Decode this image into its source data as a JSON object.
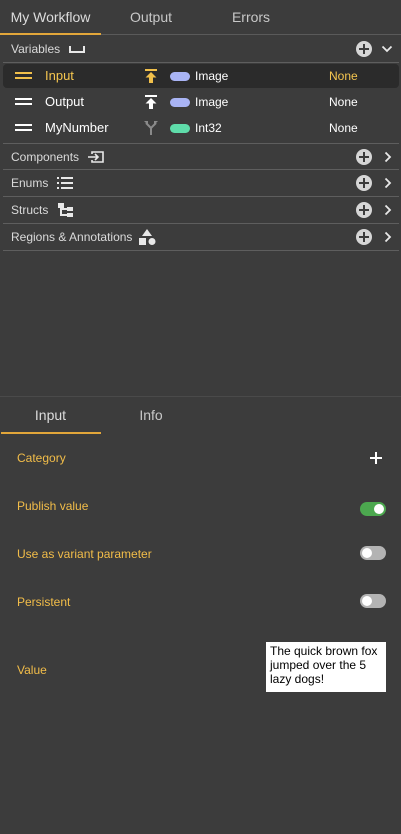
{
  "header": {
    "tabs": [
      {
        "label": "My Workflow",
        "active": true
      },
      {
        "label": "Output",
        "active": false
      },
      {
        "label": "Errors",
        "active": false
      }
    ]
  },
  "sections": {
    "variables": {
      "label": "Variables",
      "icon": "variables-icon"
    },
    "components": {
      "label": "Components",
      "icon": "component-icon"
    },
    "enums": {
      "label": "Enums",
      "icon": "list-icon"
    },
    "structs": {
      "label": "Structs",
      "icon": "struct-icon"
    },
    "regions": {
      "label": "Regions & Annotations",
      "icon": "shapes-icon"
    }
  },
  "variables": [
    {
      "name": "Input",
      "direction": "input",
      "type": "Image",
      "value": "None",
      "selected": true,
      "type_color": "#a9b4f5"
    },
    {
      "name": "Output",
      "direction": "output",
      "type": "Image",
      "value": "None",
      "selected": false,
      "type_color": "#a9b4f5"
    },
    {
      "name": "MyNumber",
      "direction": "none",
      "type": "Int32",
      "value": "None",
      "selected": false,
      "type_color": "#5fdcaa"
    }
  ],
  "inspector": {
    "tabs": [
      {
        "label": "Input",
        "active": true
      },
      {
        "label": "Info",
        "active": false
      }
    ],
    "properties": {
      "category": {
        "label": "Category"
      },
      "publish": {
        "label": "Publish value",
        "on": true
      },
      "variant": {
        "label": "Use as variant parameter",
        "on": false
      },
      "persistent": {
        "label": "Persistent",
        "on": false
      },
      "value": {
        "label": "Value",
        "text": "The quick brown fox jumped over the 5 lazy dogs!"
      }
    }
  },
  "colors": {
    "accent": "#e2a63a",
    "selected_text": "#f5c64f",
    "toggle_on": "#4ca84f",
    "toggle_off": "#b3b3b3",
    "panel": "#3c3c3c"
  }
}
